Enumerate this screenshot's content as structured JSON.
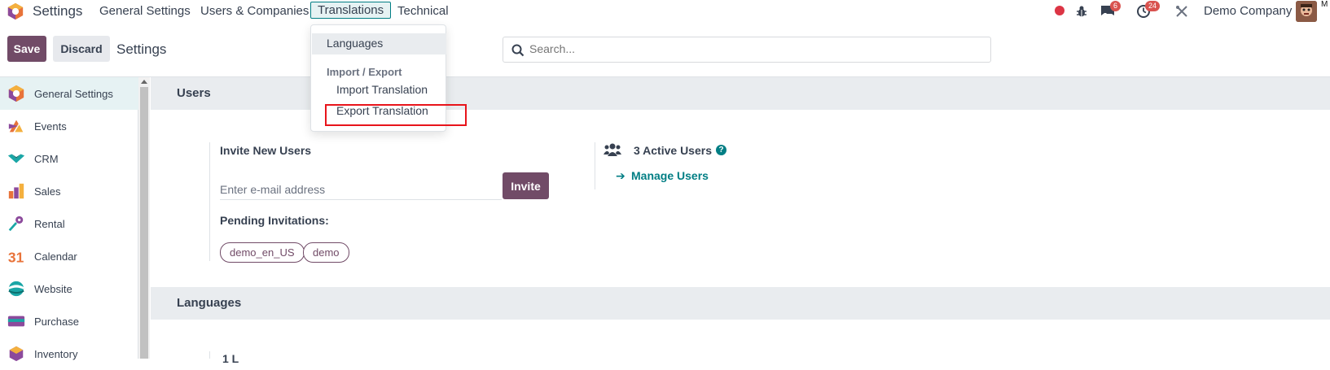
{
  "navbar": {
    "app_title": "Settings",
    "menu": [
      "General Settings",
      "Users & Companies",
      "Translations",
      "Technical"
    ],
    "active_menu": "Translations",
    "messages_badge": "6",
    "activities_badge": "24",
    "company": "Demo Company",
    "overflow_text": "M"
  },
  "control_panel": {
    "save_label": "Save",
    "discard_label": "Discard",
    "title": "Settings",
    "search_placeholder": "Search..."
  },
  "sidebar": {
    "items": [
      {
        "label": "General Settings",
        "icon": "settings-app-icon",
        "active": true
      },
      {
        "label": "Events",
        "icon": "events-app-icon"
      },
      {
        "label": "CRM",
        "icon": "crm-app-icon"
      },
      {
        "label": "Sales",
        "icon": "sales-app-icon"
      },
      {
        "label": "Rental",
        "icon": "rental-app-icon"
      },
      {
        "label": "Calendar",
        "icon": "calendar-app-icon"
      },
      {
        "label": "Website",
        "icon": "website-app-icon"
      },
      {
        "label": "Purchase",
        "icon": "purchase-app-icon"
      },
      {
        "label": "Inventory",
        "icon": "inventory-app-icon"
      }
    ],
    "calendar_icon_text": "31"
  },
  "users_section": {
    "heading": "Users",
    "invite_title": "Invite New Users",
    "email_placeholder": "Enter e-mail address",
    "invite_button": "Invite",
    "pending_title": "Pending Invitations:",
    "pending": [
      "demo_en_US",
      "demo"
    ],
    "active_users": "3 Active Users",
    "help": "?",
    "manage_users": "Manage Users",
    "arrow": "➔"
  },
  "languages_section": {
    "heading": "Languages",
    "cut_text": "1 L"
  },
  "translations_dropdown": {
    "languages": "Languages",
    "import_export_header": "Import / Export",
    "import_translation": "Import Translation",
    "export_translation": "Export Translation"
  },
  "colors": {
    "primary": "#714b67",
    "teal": "#017e84",
    "highlight": "#e8141b",
    "badge": "#d9534f"
  }
}
